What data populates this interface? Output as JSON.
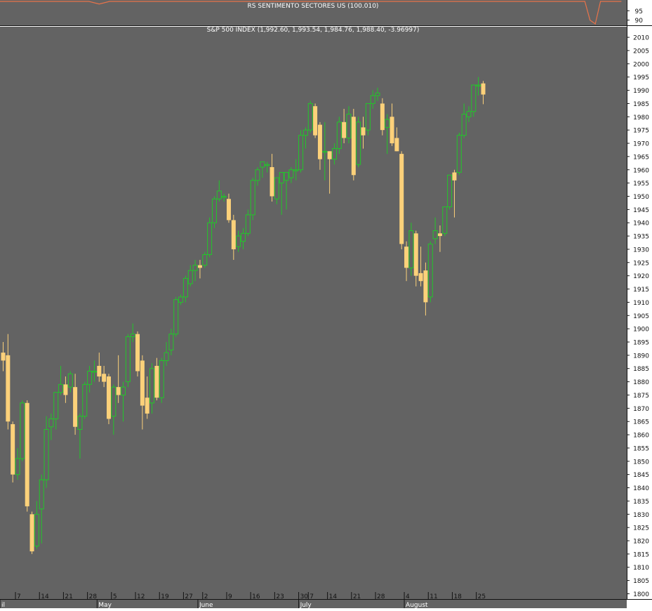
{
  "chart_data": [
    {
      "type": "line",
      "title": "RS SENTIMENTO SECTORES US (100.010)",
      "y_ticks": [
        95,
        90
      ],
      "ylim": [
        88,
        100
      ],
      "line_color": "#e8734a",
      "series": [
        {
          "x": [
            0,
            17,
            19,
            21,
            112,
            113,
            114,
            115,
            119
          ],
          "values": [
            100,
            100,
            98.6,
            100,
            100,
            90,
            88,
            100,
            100
          ]
        }
      ]
    },
    {
      "type": "candlestick",
      "title": "S&P 500 INDEX (1,992.60, 1,993.54, 1,984.76, 1,988.40, -3.96997)",
      "ylim": [
        1798,
        2014
      ],
      "y_ticks": [
        1800,
        1805,
        1810,
        1815,
        1820,
        1825,
        1830,
        1835,
        1840,
        1845,
        1850,
        1855,
        1860,
        1865,
        1870,
        1875,
        1880,
        1885,
        1890,
        1895,
        1900,
        1905,
        1910,
        1915,
        1920,
        1925,
        1930,
        1935,
        1940,
        1945,
        1950,
        1955,
        1960,
        1965,
        1970,
        1975,
        1980,
        1985,
        1990,
        1995,
        2000,
        2005,
        2010
      ],
      "x_day_ticks": [
        {
          "i": 3,
          "label": "7"
        },
        {
          "i": 8,
          "label": "14"
        },
        {
          "i": 13,
          "label": "21"
        },
        {
          "i": 18,
          "label": "28"
        },
        {
          "i": 23,
          "label": "5"
        },
        {
          "i": 28,
          "label": "12"
        },
        {
          "i": 33,
          "label": "19"
        },
        {
          "i": 38,
          "label": "27"
        },
        {
          "i": 42,
          "label": "2"
        },
        {
          "i": 47,
          "label": "9"
        },
        {
          "i": 52,
          "label": "16"
        },
        {
          "i": 57,
          "label": "23"
        },
        {
          "i": 62,
          "label": "30"
        },
        {
          "i": 64,
          "label": "7"
        },
        {
          "i": 68,
          "label": "14"
        },
        {
          "i": 73,
          "label": "21"
        },
        {
          "i": 78,
          "label": "28"
        },
        {
          "i": 84,
          "label": "4"
        },
        {
          "i": 89,
          "label": "11"
        },
        {
          "i": 94,
          "label": "18"
        },
        {
          "i": 99,
          "label": "25"
        }
      ],
      "x_month_labels": [
        {
          "i": -1,
          "label": "il"
        },
        {
          "i": 20,
          "label": "May"
        },
        {
          "i": 41,
          "label": "June"
        },
        {
          "i": 62,
          "label": "July"
        },
        {
          "i": 84,
          "label": "August"
        }
      ],
      "colors": {
        "up": "#22c72a",
        "down": "#fcd17a",
        "background": "#636363"
      },
      "candles": [
        {
          "i": 0,
          "o": 1891,
          "h": 1895,
          "l": 1884,
          "c": 1888
        },
        {
          "i": 1,
          "o": 1890,
          "h": 1898,
          "l": 1862,
          "c": 1865
        },
        {
          "i": 2,
          "o": 1864,
          "h": 1865,
          "l": 1842,
          "c": 1845
        },
        {
          "i": 3,
          "o": 1845,
          "h": 1855,
          "l": 1843,
          "c": 1851
        },
        {
          "i": 4,
          "o": 1851,
          "h": 1873,
          "l": 1850,
          "c": 1872
        },
        {
          "i": 5,
          "o": 1872,
          "h": 1873,
          "l": 1831,
          "c": 1833
        },
        {
          "i": 6,
          "o": 1830,
          "h": 1831,
          "l": 1815,
          "c": 1816
        },
        {
          "i": 7,
          "o": 1818,
          "h": 1835,
          "l": 1817,
          "c": 1830
        },
        {
          "i": 8,
          "o": 1832,
          "h": 1845,
          "l": 1819,
          "c": 1843
        },
        {
          "i": 9,
          "o": 1843,
          "h": 1867,
          "l": 1840,
          "c": 1862
        },
        {
          "i": 10,
          "o": 1863,
          "h": 1868,
          "l": 1858,
          "c": 1866
        },
        {
          "i": 11,
          "o": 1866,
          "h": 1876,
          "l": 1862,
          "c": 1876
        },
        {
          "i": 12,
          "o": 1876,
          "h": 1886,
          "l": 1875,
          "c": 1879
        },
        {
          "i": 13,
          "o": 1879,
          "h": 1882,
          "l": 1872,
          "c": 1875
        },
        {
          "i": 14,
          "o": 1878,
          "h": 1884,
          "l": 1876,
          "c": 1883
        },
        {
          "i": 15,
          "o": 1878,
          "h": 1883,
          "l": 1860,
          "c": 1863
        },
        {
          "i": 16,
          "o": 1862,
          "h": 1868,
          "l": 1851,
          "c": 1867
        },
        {
          "i": 17,
          "o": 1867,
          "h": 1880,
          "l": 1866,
          "c": 1879
        },
        {
          "i": 18,
          "o": 1879,
          "h": 1886,
          "l": 1876,
          "c": 1884
        },
        {
          "i": 19,
          "o": 1884,
          "h": 1888,
          "l": 1880,
          "c": 1884
        },
        {
          "i": 20,
          "o": 1886,
          "h": 1891,
          "l": 1880,
          "c": 1882
        },
        {
          "i": 21,
          "o": 1883,
          "h": 1886,
          "l": 1878,
          "c": 1880
        },
        {
          "i": 22,
          "o": 1882,
          "h": 1883,
          "l": 1864,
          "c": 1866
        },
        {
          "i": 23,
          "o": 1867,
          "h": 1879,
          "l": 1860,
          "c": 1878
        },
        {
          "i": 24,
          "o": 1878,
          "h": 1890,
          "l": 1872,
          "c": 1875
        },
        {
          "i": 25,
          "o": 1875,
          "h": 1880,
          "l": 1865,
          "c": 1878
        },
        {
          "i": 26,
          "o": 1880,
          "h": 1898,
          "l": 1878,
          "c": 1897
        },
        {
          "i": 27,
          "o": 1897,
          "h": 1902,
          "l": 1895,
          "c": 1898
        },
        {
          "i": 28,
          "o": 1898,
          "h": 1899,
          "l": 1882,
          "c": 1884
        },
        {
          "i": 29,
          "o": 1888,
          "h": 1890,
          "l": 1862,
          "c": 1871
        },
        {
          "i": 30,
          "o": 1874,
          "h": 1882,
          "l": 1866,
          "c": 1868
        },
        {
          "i": 31,
          "o": 1872,
          "h": 1887,
          "l": 1868,
          "c": 1885
        },
        {
          "i": 32,
          "o": 1886,
          "h": 1889,
          "l": 1873,
          "c": 1874
        },
        {
          "i": 33,
          "o": 1874,
          "h": 1889,
          "l": 1872,
          "c": 1888
        },
        {
          "i": 34,
          "o": 1888,
          "h": 1895,
          "l": 1886,
          "c": 1891
        },
        {
          "i": 35,
          "o": 1892,
          "h": 1900,
          "l": 1890,
          "c": 1898
        },
        {
          "i": 36,
          "o": 1898,
          "h": 1912,
          "l": 1897,
          "c": 1911
        },
        {
          "i": 37,
          "o": 1910,
          "h": 1913,
          "l": 1909,
          "c": 1912
        },
        {
          "i": 38,
          "o": 1912,
          "h": 1920,
          "l": 1910,
          "c": 1919
        },
        {
          "i": 39,
          "o": 1917,
          "h": 1924,
          "l": 1916,
          "c": 1922
        },
        {
          "i": 40,
          "o": 1922,
          "h": 1926,
          "l": 1918,
          "c": 1924
        },
        {
          "i": 41,
          "o": 1924,
          "h": 1926,
          "l": 1919,
          "c": 1923
        },
        {
          "i": 42,
          "o": 1924,
          "h": 1929,
          "l": 1923,
          "c": 1928
        },
        {
          "i": 43,
          "o": 1928,
          "h": 1942,
          "l": 1927,
          "c": 1940
        },
        {
          "i": 44,
          "o": 1940,
          "h": 1950,
          "l": 1938,
          "c": 1949
        },
        {
          "i": 45,
          "o": 1949,
          "h": 1956,
          "l": 1948,
          "c": 1952
        },
        {
          "i": 46,
          "o": 1950,
          "h": 1951,
          "l": 1948,
          "c": 1950
        },
        {
          "i": 47,
          "o": 1949,
          "h": 1951,
          "l": 1940,
          "c": 1941
        },
        {
          "i": 48,
          "o": 1941,
          "h": 1943,
          "l": 1926,
          "c": 1930
        },
        {
          "i": 49,
          "o": 1931,
          "h": 1937,
          "l": 1929,
          "c": 1935
        },
        {
          "i": 50,
          "o": 1933,
          "h": 1938,
          "l": 1930,
          "c": 1936
        },
        {
          "i": 51,
          "o": 1936,
          "h": 1945,
          "l": 1935,
          "c": 1943
        },
        {
          "i": 52,
          "o": 1943,
          "h": 1957,
          "l": 1941,
          "c": 1956
        },
        {
          "i": 53,
          "o": 1956,
          "h": 1961,
          "l": 1954,
          "c": 1960
        },
        {
          "i": 54,
          "o": 1961,
          "h": 1963,
          "l": 1957,
          "c": 1963
        },
        {
          "i": 55,
          "o": 1962,
          "h": 1963,
          "l": 1959,
          "c": 1962
        },
        {
          "i": 56,
          "o": 1961,
          "h": 1966,
          "l": 1948,
          "c": 1950
        },
        {
          "i": 57,
          "o": 1949,
          "h": 1957,
          "l": 1947,
          "c": 1957
        },
        {
          "i": 58,
          "o": 1955,
          "h": 1958,
          "l": 1943,
          "c": 1959
        },
        {
          "i": 59,
          "o": 1956,
          "h": 1959,
          "l": 1945,
          "c": 1959
        },
        {
          "i": 60,
          "o": 1957,
          "h": 1961,
          "l": 1955,
          "c": 1960
        },
        {
          "i": 61,
          "o": 1960,
          "h": 1964,
          "l": 1956,
          "c": 1960
        },
        {
          "i": 62,
          "o": 1960,
          "h": 1975,
          "l": 1959,
          "c": 1973
        },
        {
          "i": 63,
          "o": 1973,
          "h": 1976,
          "l": 1968,
          "c": 1975
        },
        {
          "i": 64,
          "o": 1975,
          "h": 1986,
          "l": 1974,
          "c": 1985
        },
        {
          "i": 65,
          "o": 1984,
          "h": 1985,
          "l": 1972,
          "c": 1973
        },
        {
          "i": 66,
          "o": 1977,
          "h": 1978,
          "l": 1960,
          "c": 1964
        },
        {
          "i": 67,
          "o": 1967,
          "h": 1978,
          "l": 1956,
          "c": 1967
        },
        {
          "i": 68,
          "o": 1967,
          "h": 1967,
          "l": 1951,
          "c": 1964
        },
        {
          "i": 69,
          "o": 1964,
          "h": 1970,
          "l": 1962,
          "c": 1968
        },
        {
          "i": 70,
          "o": 1968,
          "h": 1980,
          "l": 1966,
          "c": 1978
        },
        {
          "i": 71,
          "o": 1978,
          "h": 1983,
          "l": 1970,
          "c": 1972
        },
        {
          "i": 72,
          "o": 1972,
          "h": 1984,
          "l": 1970,
          "c": 1981
        },
        {
          "i": 73,
          "o": 1980,
          "h": 1983,
          "l": 1956,
          "c": 1958
        },
        {
          "i": 74,
          "o": 1962,
          "h": 1980,
          "l": 1961,
          "c": 1978
        },
        {
          "i": 75,
          "o": 1976,
          "h": 1980,
          "l": 1968,
          "c": 1973
        },
        {
          "i": 76,
          "o": 1975,
          "h": 1985,
          "l": 1973,
          "c": 1985
        },
        {
          "i": 77,
          "o": 1985,
          "h": 1990,
          "l": 1983,
          "c": 1988
        },
        {
          "i": 78,
          "o": 1988,
          "h": 1991,
          "l": 1986,
          "c": 1989
        },
        {
          "i": 79,
          "o": 1985,
          "h": 1987,
          "l": 1973,
          "c": 1975
        },
        {
          "i": 80,
          "o": 1976,
          "h": 1981,
          "l": 1966,
          "c": 1979
        },
        {
          "i": 81,
          "o": 1980,
          "h": 1985,
          "l": 1969,
          "c": 1970
        },
        {
          "i": 82,
          "o": 1972,
          "h": 1976,
          "l": 1967,
          "c": 1967
        },
        {
          "i": 83,
          "o": 1966,
          "h": 1967,
          "l": 1930,
          "c": 1932
        },
        {
          "i": 84,
          "o": 1931,
          "h": 1933,
          "l": 1918,
          "c": 1923
        },
        {
          "i": 85,
          "o": 1923,
          "h": 1940,
          "l": 1920,
          "c": 1937
        },
        {
          "i": 86,
          "o": 1936,
          "h": 1937,
          "l": 1916,
          "c": 1920
        },
        {
          "i": 87,
          "o": 1921,
          "h": 1931,
          "l": 1916,
          "c": 1918
        },
        {
          "i": 88,
          "o": 1922,
          "h": 1925,
          "l": 1905,
          "c": 1910
        },
        {
          "i": 89,
          "o": 1912,
          "h": 1933,
          "l": 1910,
          "c": 1932
        },
        {
          "i": 90,
          "o": 1934,
          "h": 1942,
          "l": 1932,
          "c": 1937
        },
        {
          "i": 91,
          "o": 1936,
          "h": 1939,
          "l": 1929,
          "c": 1935
        },
        {
          "i": 92,
          "o": 1936,
          "h": 1946,
          "l": 1935,
          "c": 1946
        },
        {
          "i": 93,
          "o": 1946,
          "h": 1958,
          "l": 1945,
          "c": 1958
        },
        {
          "i": 94,
          "o": 1959,
          "h": 1960,
          "l": 1942,
          "c": 1956
        },
        {
          "i": 95,
          "o": 1959,
          "h": 1974,
          "l": 1958,
          "c": 1973
        },
        {
          "i": 96,
          "o": 1973,
          "h": 1985,
          "l": 1972,
          "c": 1981
        },
        {
          "i": 97,
          "o": 1980,
          "h": 1984,
          "l": 1978,
          "c": 1982
        },
        {
          "i": 98,
          "o": 1982,
          "h": 1992,
          "l": 1980,
          "c": 1992
        },
        {
          "i": 99,
          "o": 1992,
          "h": 1995,
          "l": 1988,
          "c": 1992
        },
        {
          "i": 100,
          "o": 1992.6,
          "h": 1993.54,
          "l": 1984.76,
          "c": 1988.4
        }
      ]
    }
  ]
}
